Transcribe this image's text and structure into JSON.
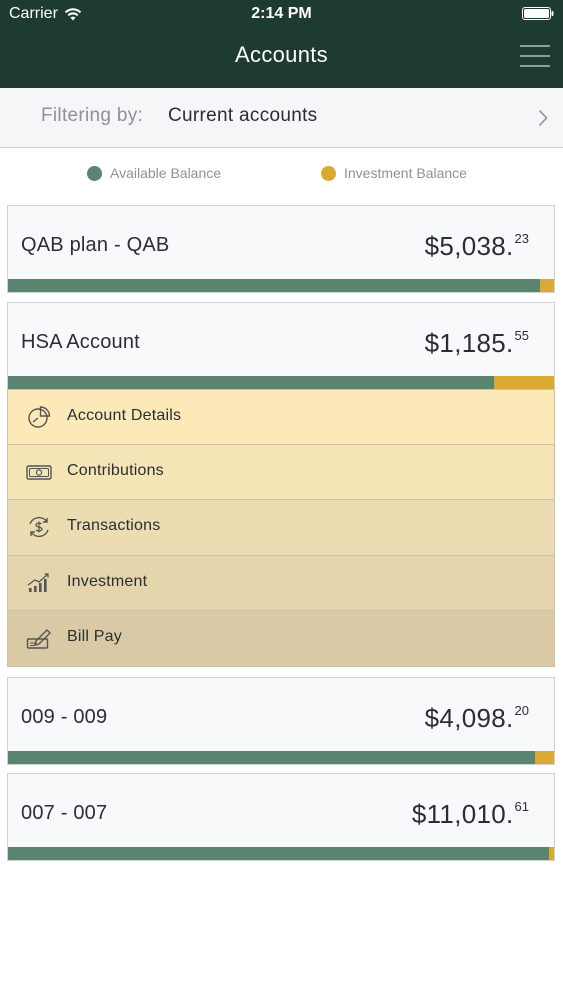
{
  "status_bar": {
    "carrier": "Carrier",
    "time": "2:14 PM"
  },
  "header": {
    "title": "Accounts",
    "menu_icon": "hamburger-menu-icon"
  },
  "filter": {
    "label": "Filtering by:",
    "value": "Current accounts"
  },
  "legend": {
    "available": "Available Balance",
    "investment": "Investment Balance"
  },
  "colors": {
    "header_bg": "#1e3b2f",
    "available": "#5b8470",
    "investment": "#d9a934"
  },
  "accounts": [
    {
      "name": "QAB plan - QAB",
      "balance_main": "$5,038.",
      "balance_cents": "23",
      "available_fraction": 0.975
    },
    {
      "name": "HSA Account",
      "balance_main": "$1,185.",
      "balance_cents": "55",
      "available_fraction": 0.89
    },
    {
      "name": "009 - 009",
      "balance_main": "$4,098.",
      "balance_cents": "20",
      "available_fraction": 0.965
    },
    {
      "name": "007 - 007",
      "balance_main": "$11,010.",
      "balance_cents": "61",
      "available_fraction": 0.99
    }
  ],
  "hsa_menu": [
    {
      "label": "Account Details",
      "icon": "pie-chart-icon",
      "bg": "#fbeab8"
    },
    {
      "label": "Contributions",
      "icon": "cash-icon",
      "bg": "#f5e4b6"
    },
    {
      "label": "Transactions",
      "icon": "dollar-cycle-icon",
      "bg": "#ecdcb1"
    },
    {
      "label": "Investment",
      "icon": "growth-chart-icon",
      "bg": "#e4d5ad"
    },
    {
      "label": "Bill Pay",
      "icon": "check-payment-icon",
      "bg": "#d9caa5"
    }
  ]
}
